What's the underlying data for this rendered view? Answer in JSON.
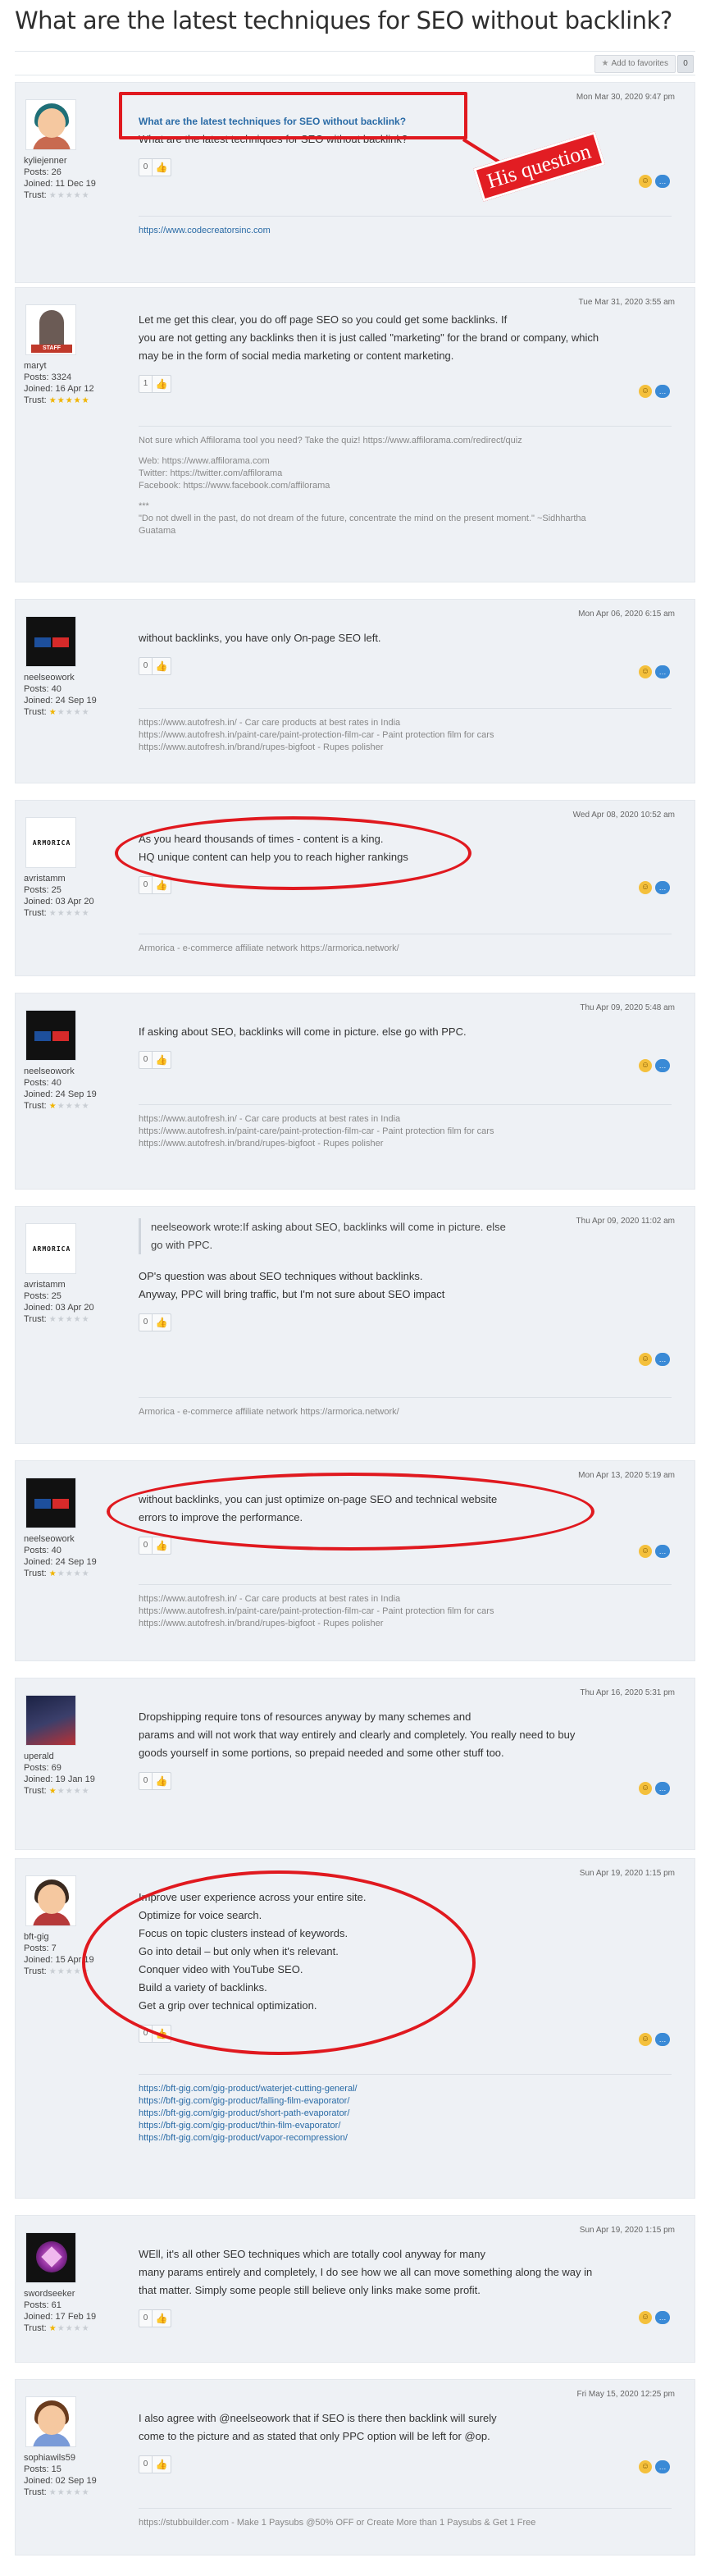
{
  "page": {
    "title": "What are the latest techniques for SEO without backlink?"
  },
  "favorites": {
    "label": "Add to favorites",
    "count": "0"
  },
  "annotation": {
    "label": "His question"
  },
  "posts": [
    {
      "date": "Mon Mar 30, 2020 9:47 pm",
      "user": {
        "name": "kyliejenner",
        "posts": "Posts: 26",
        "joined": "Joined: 11 Dec 19",
        "trust": "Trust:"
      },
      "title": "What are the latest techniques for SEO without backlink?",
      "lines": [
        "What are the latest techniques for SEO without backlink?"
      ],
      "likes": "0",
      "sig": [
        "https://www.codecreatorsinc.com"
      ]
    },
    {
      "date": "Tue Mar 31, 2020 3:55 am",
      "user": {
        "name": "maryt",
        "posts": "Posts: 3324",
        "joined": "Joined: 16 Apr 12",
        "trust": "Trust:",
        "badge": "STAFF"
      },
      "lines": [
        "Let me get this clear, you do off page SEO so you could get some backlinks. If",
        "you are not getting any backlinks then it is just called \"marketing\" for the brand or company, which",
        "may be in the form of social media marketing or content marketing."
      ],
      "likes": "1",
      "sig": [
        "Not sure which Affilorama tool you need? Take the quiz! https://www.affilorama.com/redirect/quiz",
        "",
        "Web: https://www.affilorama.com",
        "Twitter: https://twitter.com/affilorama",
        "Facebook: https://www.facebook.com/affilorama",
        "",
        "***",
        "\"Do not dwell in the past, do not dream of the future, concentrate the mind on the present moment.\" ~Sidhhartha",
        "Guatama"
      ]
    },
    {
      "date": "Mon Apr 06, 2020 6:15 am",
      "user": {
        "name": "neelseowork",
        "posts": "Posts: 40",
        "joined": "Joined: 24 Sep 19",
        "trust": "Trust:"
      },
      "lines": [
        "without backlinks, you have only On-page SEO left."
      ],
      "likes": "0",
      "sig": [
        "https://www.autofresh.in/ - Car care products at best rates in India",
        "https://www.autofresh.in/paint-care/paint-protection-film-car - Paint protection film for cars",
        "https://www.autofresh.in/brand/rupes-bigfoot - Rupes polisher"
      ]
    },
    {
      "date": "Wed Apr 08, 2020 10:52 am",
      "user": {
        "name": "avristamm",
        "posts": "Posts: 25",
        "joined": "Joined: 03 Apr 20",
        "trust": "Trust:",
        "logo": "ARMORICA"
      },
      "lines": [
        "As you heard thousands of times - content is a king.",
        "HQ unique content can help you to reach higher rankings"
      ],
      "likes": "0",
      "sig": [
        "Armorica - e-commerce affiliate network https://armorica.network/"
      ]
    },
    {
      "date": "Thu Apr 09, 2020 5:48 am",
      "user": {
        "name": "neelseowork",
        "posts": "Posts: 40",
        "joined": "Joined: 24 Sep 19",
        "trust": "Trust:"
      },
      "lines": [
        "If asking about SEO, backlinks will come in picture. else go with PPC."
      ],
      "likes": "0",
      "sig": [
        "https://www.autofresh.in/ - Car care products at best rates in India",
        "https://www.autofresh.in/paint-care/paint-protection-film-car - Paint protection film for cars",
        "https://www.autofresh.in/brand/rupes-bigfoot - Rupes polisher"
      ]
    },
    {
      "date": "Thu Apr 09, 2020 11:02 am",
      "user": {
        "name": "avristamm",
        "posts": "Posts: 25",
        "joined": "Joined: 03 Apr 20",
        "trust": "Trust:",
        "logo": "ARMORICA"
      },
      "quote": [
        "neelseowork wrote:If asking about SEO, backlinks will come in picture. else",
        "go with PPC."
      ],
      "lines": [
        "OP's question was about SEO techniques without backlinks.",
        "Anyway, PPC will bring traffic, but I'm not sure about SEO impact"
      ],
      "likes": "0",
      "sig": [
        "Armorica - e-commerce affiliate network https://armorica.network/"
      ]
    },
    {
      "date": "Mon Apr 13, 2020 5:19 am",
      "user": {
        "name": "neelseowork",
        "posts": "Posts: 40",
        "joined": "Joined: 24 Sep 19",
        "trust": "Trust:"
      },
      "lines": [
        "without backlinks, you can just optimize on-page SEO and technical website",
        "errors to improve the performance."
      ],
      "likes": "0",
      "sig": [
        "https://www.autofresh.in/ - Car care products at best rates in India",
        "https://www.autofresh.in/paint-care/paint-protection-film-car - Paint protection film for cars",
        "https://www.autofresh.in/brand/rupes-bigfoot - Rupes polisher"
      ]
    },
    {
      "date": "Thu Apr 16, 2020 5:31 pm",
      "user": {
        "name": "uperald",
        "posts": "Posts: 69",
        "joined": "Joined: 19 Jan 19",
        "trust": "Trust:"
      },
      "lines": [
        "Dropshipping require tons of resources anyway by many schemes and",
        "params and will not work that way entirely and clearly and completely. You really need to buy",
        "goods yourself in some portions, so prepaid needed and some other stuff too."
      ],
      "likes": "0",
      "sig": []
    },
    {
      "date": "Sun Apr 19, 2020 1:15 pm",
      "user": {
        "name": "bft-gig",
        "posts": "Posts: 7",
        "joined": "Joined: 15 Apr 19",
        "trust": "Trust:"
      },
      "lines": [
        "Improve user experience across your entire site.",
        "Optimize for voice search.",
        "Focus on topic clusters instead of keywords.",
        "Go into detail – but only when it's relevant.",
        "Conquer video with YouTube SEO.",
        "Build a variety of backlinks.",
        "Get a grip over technical optimization."
      ],
      "likes": "0",
      "sig": [
        "https://bft-gig.com/gig-product/waterjet-cutting-general/",
        "https://bft-gig.com/gig-product/falling-film-evaporator/",
        "https://bft-gig.com/gig-product/short-path-evaporator/",
        "https://bft-gig.com/gig-product/thin-film-evaporator/",
        "https://bft-gig.com/gig-product/vapor-recompression/"
      ]
    },
    {
      "date": "Sun Apr 19, 2020 1:15 pm",
      "user": {
        "name": "swordseeker",
        "posts": "Posts: 61",
        "joined": "Joined: 17 Feb 19",
        "trust": "Trust:"
      },
      "lines": [
        "WEll, it's all other SEO techniques which are totally cool anyway for many",
        "many params entirely and completely, I do see how we all can move something along the way in",
        "that matter. Simply some people still believe only links make some profit."
      ],
      "likes": "0",
      "sig": []
    },
    {
      "date": "Fri May 15, 2020 12:25 pm",
      "user": {
        "name": "sophiawils59",
        "posts": "Posts: 15",
        "joined": "Joined: 02 Sep 19",
        "trust": "Trust:"
      },
      "lines": [
        "I also agree with @neelseowork that if SEO is there then backlink will surely",
        "come to the picture and as stated that only PPC option will be left for @op."
      ],
      "likes": "0",
      "sig": [
        "https://stubbuilder.com - Make 1 Paysubs @50% OFF or Create More than 1 Paysubs & Get 1 Free"
      ]
    }
  ]
}
